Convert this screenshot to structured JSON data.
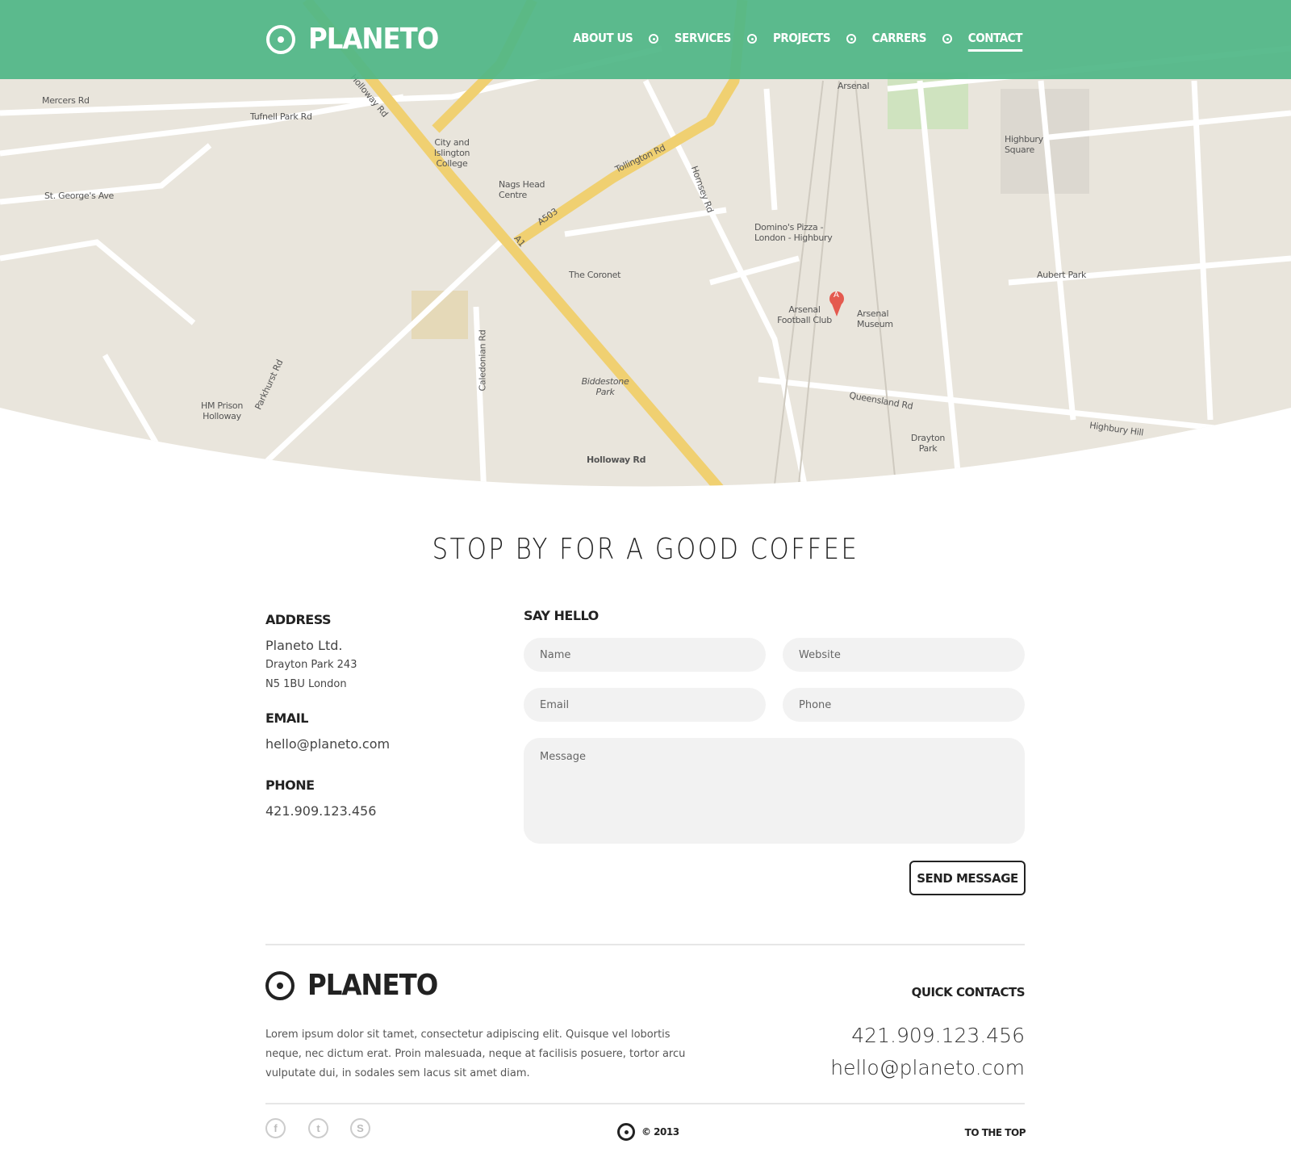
{
  "brand": {
    "name": "PLANETO",
    "accent": "#5bbb8f"
  },
  "nav": {
    "items": [
      {
        "label": "ABOUT US"
      },
      {
        "label": "SERVICES"
      },
      {
        "label": "PROJECTS"
      },
      {
        "label": "CARRERS"
      },
      {
        "label": "CONTACT",
        "active": true
      }
    ]
  },
  "map": {
    "labels": [
      "Mercers Rd",
      "Tufnell Park Rd",
      "St. George's Ave",
      "Holloway Rd",
      "City and Islington College",
      "Nags Head Centre",
      "Tollington Rd",
      "A503",
      "A1",
      "Hornsey Rd",
      "Arsenal",
      "Domino's Pizza - London - Highbury",
      "Arsenal Football Club",
      "Arsenal Museum",
      "The Coronet",
      "Biddestone Park",
      "Holloway Rd",
      "Drayton Park",
      "Highbury Square",
      "Aubert Park",
      "Caledonian Rd",
      "HM Prison Holloway",
      "Parkhurst Rd",
      "Queensland Rd",
      "Highbury Hill"
    ],
    "marker": "A"
  },
  "heading": "STOP BY FOR A GOOD COFFEE",
  "contact": {
    "address_title": "ADDRESS",
    "company": "Planeto Ltd.",
    "street": "Drayton Park 243",
    "city": "N5 1BU London",
    "email_title": "EMAIL",
    "email": "hello@planeto.com",
    "phone_title": "PHONE",
    "phone": "421.909.123.456"
  },
  "form": {
    "title": "SAY HELLO",
    "name_placeholder": "Name",
    "website_placeholder": "Website",
    "email_placeholder": "Email",
    "phone_placeholder": "Phone",
    "message_placeholder": "Message",
    "send_label": "SEND MESSAGE"
  },
  "footer": {
    "about": "Lorem ipsum dolor sit tamet, consectetur adipiscing elit. Quisque vel lobortis neque, nec dictum erat. Proin malesuada, neque at facilisis posuere, tortor arcu vulputate dui, in sodales sem lacus sit amet diam.",
    "quick_title": "QUICK CONTACTS",
    "phone": "421.909.123.456",
    "email": "hello@planeto.com",
    "social": [
      {
        "icon": "facebook-icon",
        "glyph": "f"
      },
      {
        "icon": "twitter-icon",
        "glyph": "t"
      },
      {
        "icon": "skype-icon",
        "glyph": "S"
      }
    ],
    "copyright": "© 2013",
    "to_top": "TO THE TOP"
  }
}
